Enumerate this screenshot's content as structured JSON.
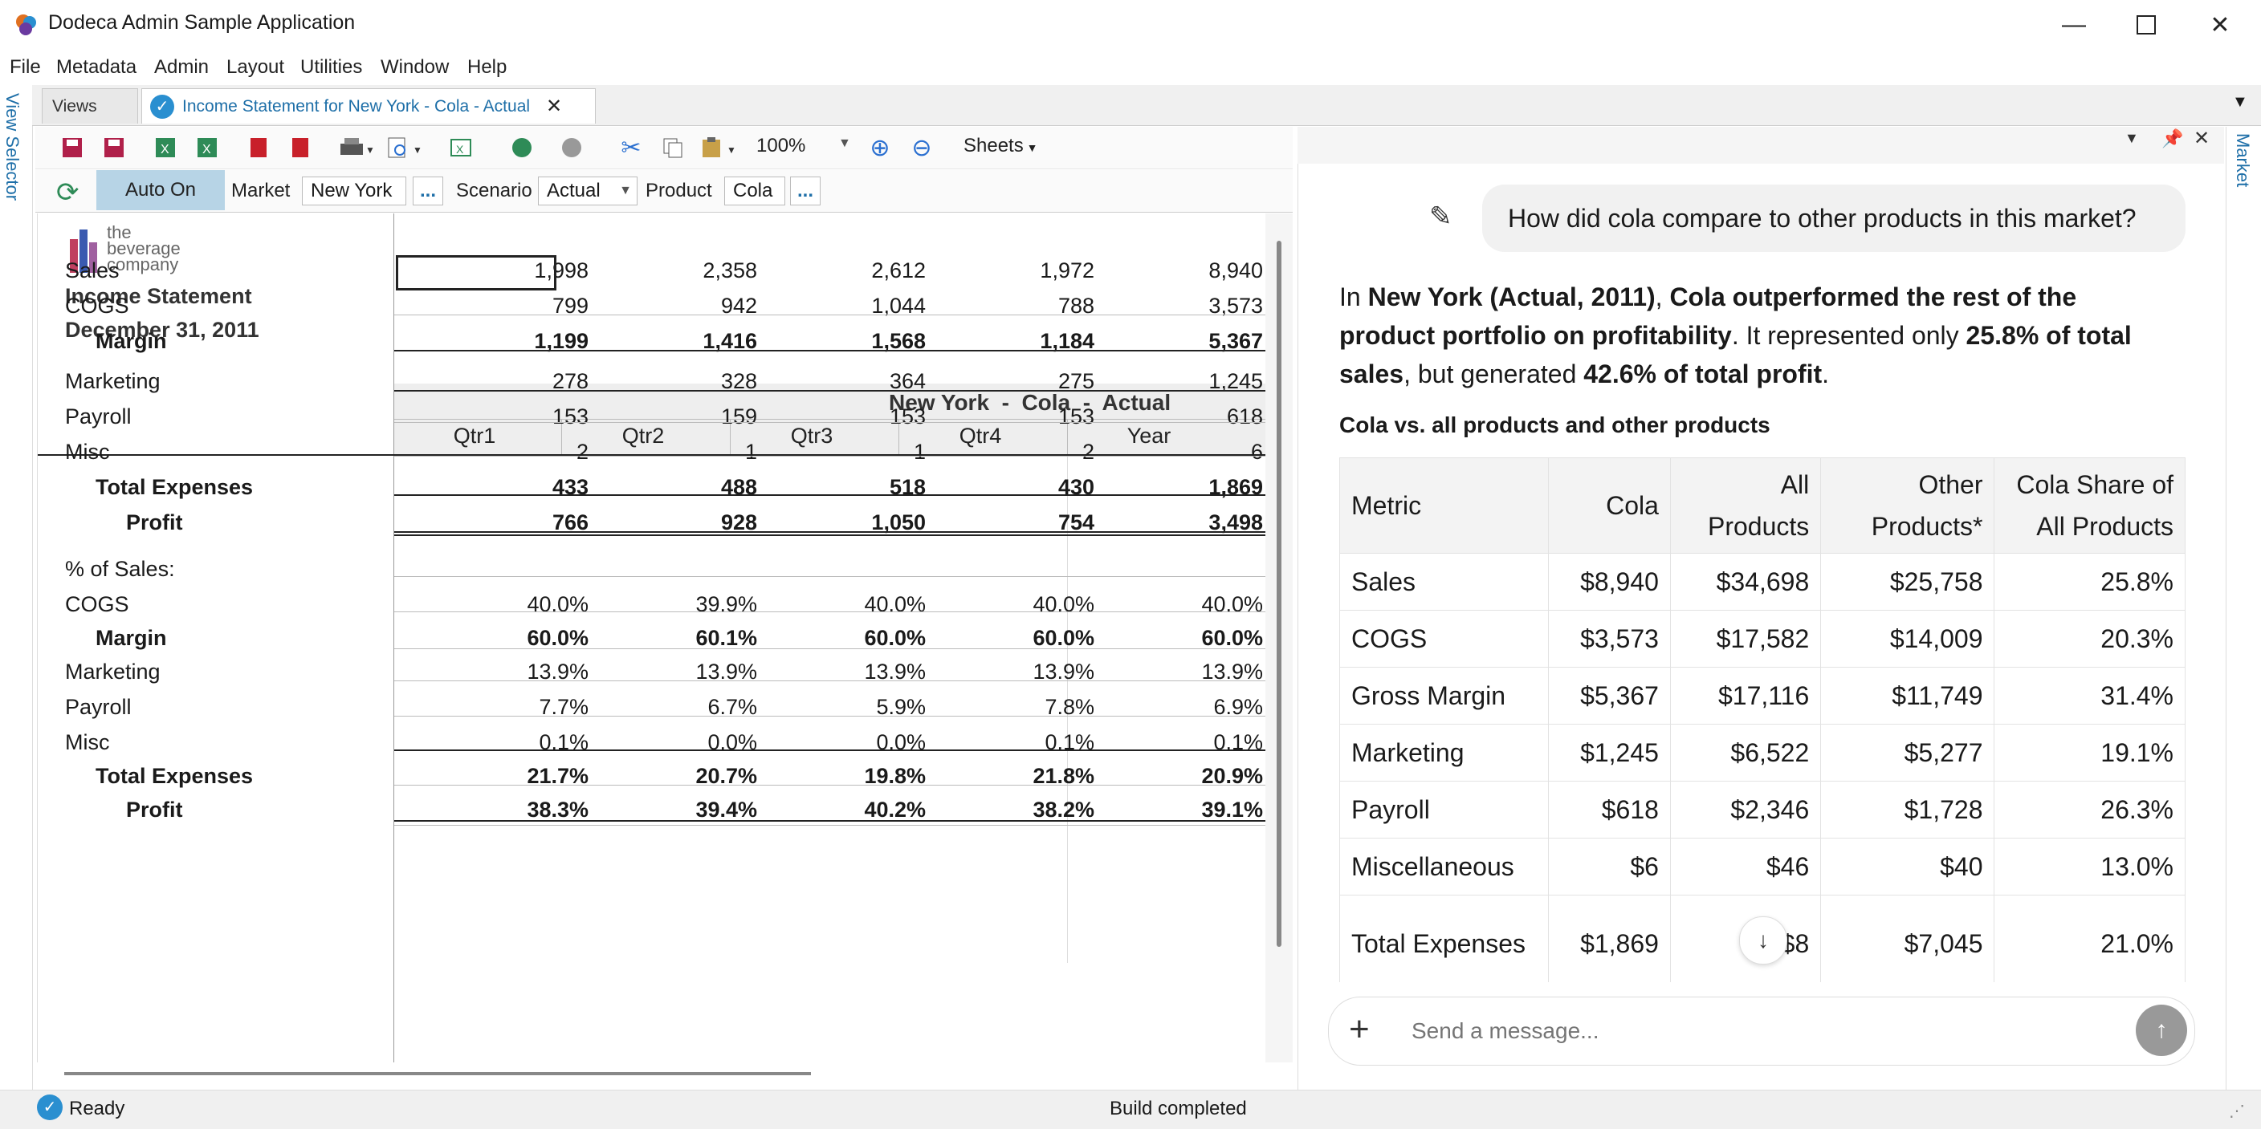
{
  "window": {
    "title": "Dodeca Admin Sample Application"
  },
  "menu": [
    "File",
    "Metadata",
    "Admin",
    "Layout",
    "Utilities",
    "Window",
    "Help"
  ],
  "side": {
    "left": "View Selector",
    "right": "Market"
  },
  "tabs": {
    "views": "Views",
    "active": "Income Statement for New York - Cola - Actual"
  },
  "toolbar": {
    "zoom": "100%",
    "sheets": "Sheets"
  },
  "selectors": {
    "auto": "Auto On",
    "market_label": "Market",
    "market_value": "New York",
    "scenario_label": "Scenario",
    "scenario_value": "Actual",
    "product_label": "Product",
    "product_value": "Cola",
    "more": "..."
  },
  "report": {
    "logo": {
      "l1": "the",
      "l2": "beverage",
      "l3": "company"
    },
    "title": "Income Statement",
    "date": "December 31, 2011",
    "banner": "New York  -  Cola  -  Actual",
    "columns": [
      "Qtr1",
      "Qtr2",
      "Qtr3",
      "Qtr4",
      "Year"
    ],
    "rows": [
      {
        "label": "Sales",
        "values": [
          "1,998",
          "2,358",
          "2,612",
          "1,972",
          "8,940"
        ]
      },
      {
        "label": "COGS",
        "values": [
          "799",
          "942",
          "1,044",
          "788",
          "3,573"
        ]
      },
      {
        "label": "Margin",
        "values": [
          "1,199",
          "1,416",
          "1,568",
          "1,184",
          "5,367"
        ]
      },
      {
        "label": "Marketing",
        "values": [
          "278",
          "328",
          "364",
          "275",
          "1,245"
        ]
      },
      {
        "label": "Payroll",
        "values": [
          "153",
          "159",
          "153",
          "153",
          "618"
        ]
      },
      {
        "label": "Misc",
        "values": [
          "2",
          "1",
          "1",
          "2",
          "6"
        ]
      },
      {
        "label": "Total Expenses",
        "values": [
          "433",
          "488",
          "518",
          "430",
          "1,869"
        ]
      },
      {
        "label": "Profit",
        "values": [
          "766",
          "928",
          "1,050",
          "754",
          "3,498"
        ]
      },
      {
        "label": "% of Sales:",
        "values": [
          "",
          "",
          "",
          "",
          ""
        ]
      },
      {
        "label": "COGS",
        "values": [
          "40.0%",
          "39.9%",
          "40.0%",
          "40.0%",
          "40.0%"
        ]
      },
      {
        "label": "Margin",
        "values": [
          "60.0%",
          "60.1%",
          "60.0%",
          "60.0%",
          "60.0%"
        ]
      },
      {
        "label": "Marketing",
        "values": [
          "13.9%",
          "13.9%",
          "13.9%",
          "13.9%",
          "13.9%"
        ]
      },
      {
        "label": "Payroll",
        "values": [
          "7.7%",
          "6.7%",
          "5.9%",
          "7.8%",
          "6.9%"
        ]
      },
      {
        "label": "Misc",
        "values": [
          "0.1%",
          "0.0%",
          "0.0%",
          "0.1%",
          "0.1%"
        ]
      },
      {
        "label": "Total Expenses",
        "values": [
          "21.7%",
          "20.7%",
          "19.8%",
          "21.8%",
          "20.9%"
        ]
      },
      {
        "label": "Profit",
        "values": [
          "38.3%",
          "39.4%",
          "40.2%",
          "38.2%",
          "39.1%"
        ]
      }
    ]
  },
  "status": {
    "left": "Ready",
    "center": "Build completed"
  },
  "chat": {
    "question": "How did cola compare to other products in this market?",
    "answer": {
      "p1": "In ",
      "b1": "New York (Actual, 2011)",
      "p2": ", ",
      "b2": "Cola outperformed the rest of the product portfolio on profitability",
      "p3": ". It represented only ",
      "b3": "25.8% of total sales",
      "p4": ", but generated ",
      "b4": "42.6% of total profit",
      "p5": "."
    },
    "caption": "Cola vs. all products and other products",
    "table": {
      "headers": [
        "Metric",
        "Cola",
        "All Products",
        "Other Products*",
        "Cola Share of All Products"
      ],
      "rows": [
        [
          "Sales",
          "$8,940",
          "$34,698",
          "$25,758",
          "25.8%"
        ],
        [
          "COGS",
          "$3,573",
          "$17,582",
          "$14,009",
          "20.3%"
        ],
        [
          "Gross Margin",
          "$5,367",
          "$17,116",
          "$11,749",
          "31.4%"
        ],
        [
          "Marketing",
          "$1,245",
          "$6,522",
          "$5,277",
          "19.1%"
        ],
        [
          "Payroll",
          "$618",
          "$2,346",
          "$1,728",
          "26.3%"
        ],
        [
          "Miscellaneous",
          "$6",
          "$46",
          "$40",
          "13.0%"
        ],
        [
          "Total Expenses",
          "$1,869",
          "$8",
          "$7,045",
          "21.0%"
        ]
      ]
    },
    "placeholder": "Send a message..."
  }
}
